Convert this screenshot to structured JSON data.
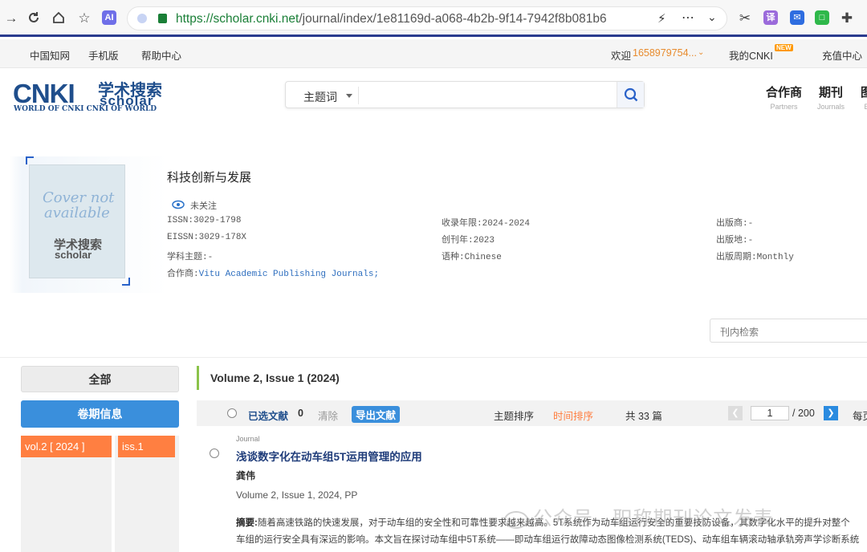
{
  "browser": {
    "url_host": "https://scholar.cnki.net",
    "url_path": "/journal/index/1e81169d-a068-4b2b-9f14-7942f8b081b6",
    "nav_icons": [
      "back-arrow-icon",
      "reload-icon",
      "home-icon",
      "favorites-icon",
      "ai-icon"
    ],
    "ai_label": "AI",
    "ext_translate_label": "译"
  },
  "topnav": {
    "links": [
      "中国知网",
      "手机版",
      "帮助中心"
    ],
    "welcome": "欢迎",
    "username": "1658979754...",
    "my_cnki": "我的CNKI",
    "new_badge": "NEW",
    "recharge": "充值中心"
  },
  "header": {
    "logo_main": "CNKI",
    "logo_cn": "学术搜索",
    "logo_sub": "scholar",
    "logo_tagline": "WORLD OF CNKI CNKI OF WORLD",
    "search_field": "主题词",
    "nav": [
      {
        "cn": "合作商",
        "en": "Partners"
      },
      {
        "cn": "期刊",
        "en": "Journals"
      },
      {
        "cn": "图",
        "en": "B"
      }
    ]
  },
  "journal": {
    "cover_text_1": "Cover not",
    "cover_text_2": "available",
    "cover_logo_cn": "学术搜索",
    "cover_logo_en": "scholar",
    "title": "科技创新与发展",
    "follow": "未关注",
    "issn": "ISSN:3029-1798",
    "eissn": "EISSN:3029-178X",
    "subject": "学科主题:-",
    "partner_label": "合作商:",
    "partner_value": "Vitu Academic Publishing Journals;",
    "years": "收录年限:2024-2024",
    "founded": "创刊年:2023",
    "language": "语种:Chinese",
    "publisher": "出版商:-",
    "place": "出版地:-",
    "frequency": "出版周期:Monthly",
    "inner_search_placeholder": "刊内检索"
  },
  "sidebar": {
    "all": "全部",
    "volume_info": "卷期信息",
    "volume": "vol.2 [ 2024 ]",
    "issue": "iss.1"
  },
  "list": {
    "heading": "Volume 2, Issue 1 (2024)",
    "selected_label": "已选文献",
    "selected_count": "0",
    "clear": "清除",
    "export": "导出文献",
    "sort_topic": "主题排序",
    "sort_time": "时间排序",
    "total": "共 33 篇",
    "page_current": "1",
    "page_total": "/ 200",
    "per_page": "每页"
  },
  "article": {
    "type": "Journal",
    "title": "浅谈数字化在动车组5T运用管理的应用",
    "author": "龚伟",
    "source": "Volume 2, Issue 1, 2024, PP",
    "abstract_label": "摘要:",
    "abstract_line1": "随着高速铁路的快速发展，对于动车组的安全性和可靠性要求越来越高。5T系统作为动车组运行安全的重要技防设备，其数字化水平的提升对整个",
    "abstract_line2": "车组的运行安全具有深远的影响。本文旨在探讨动车组中5T系统——即动车组运行故障动态图像检测系统(TEDS)、动车组车辆滚动轴承轨旁声学诊断系统"
  },
  "watermark": "公众号 · 职称期刊论文发表",
  "colors": {
    "accent_blue": "#3a8fdc",
    "orange": "#ff7f41",
    "green_bar": "#8bc34a",
    "link_green": "#1a7f37"
  }
}
